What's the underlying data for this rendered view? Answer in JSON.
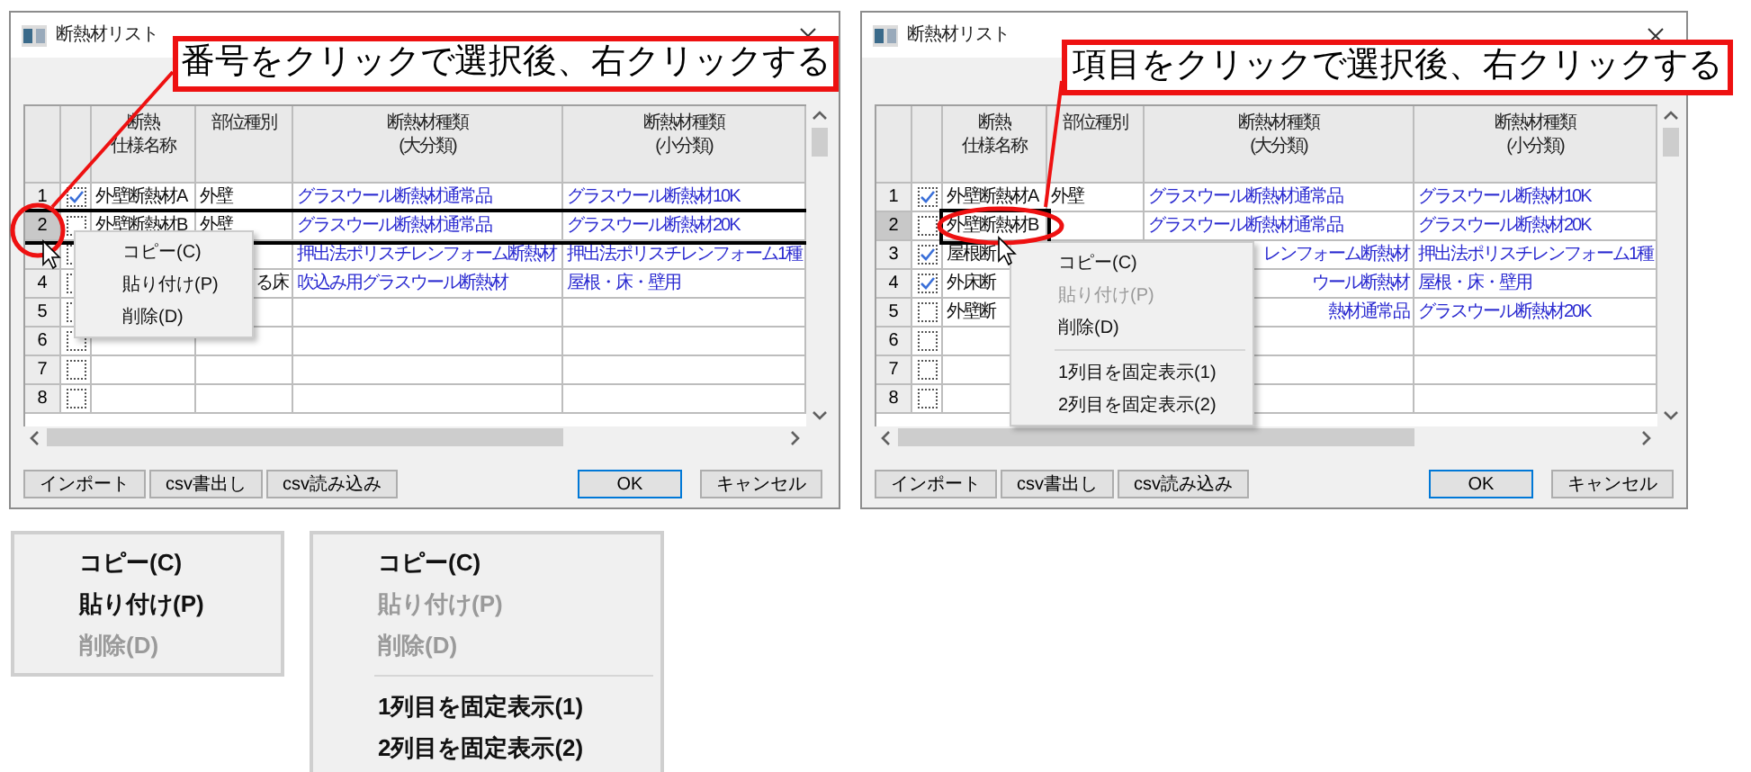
{
  "windows": [
    {
      "title": "断熱材リスト",
      "callout": "番号をクリックで選択後、右クリックする",
      "table": {
        "cell_selection": false,
        "columns": [
          {
            "lines": [
              "断熱",
              "仕様名称"
            ]
          },
          {
            "lines": [
              "部位種別"
            ]
          },
          {
            "lines": [
              "断熱材種類",
              "(大分類)"
            ]
          },
          {
            "lines": [
              "断熱材種類",
              "(小分類)"
            ]
          }
        ],
        "rows": [
          {
            "number": "1",
            "checked": true,
            "selected": false,
            "cells": [
              {
                "text": "外壁断熱材A"
              },
              {
                "text": "外壁"
              },
              {
                "text": "グラスウール断熱材通常品"
              },
              {
                "text": "グラスウール断熱材10K"
              }
            ]
          },
          {
            "number": "2",
            "checked": false,
            "selected": true,
            "cells": [
              {
                "text": "外壁断熱材B"
              },
              {
                "text": "外壁"
              },
              {
                "text": "グラスウール断熱材通常品"
              },
              {
                "text": "グラスウール断熱材20K"
              }
            ]
          },
          {
            "checked": false,
            "selected": false,
            "cells": [
              {},
              {},
              {
                "text": "押出法ポリスチレンフォーム断熱材"
              },
              {
                "text": "押出法ポリスチレンフォーム1種"
              }
            ]
          },
          {
            "number": "4",
            "checked": false,
            "selected": false,
            "cells": [
              {},
              {
                "text": "る床",
                "clipped": true
              },
              {
                "text": "吹込み用グラスウール断熱材"
              },
              {
                "text": "屋根・床・壁用"
              }
            ]
          },
          {
            "number": "5",
            "checked": false,
            "selected": false,
            "cells": [
              {},
              {},
              {},
              {}
            ]
          },
          {
            "number": "6",
            "checked": false,
            "selected": false,
            "cells": [
              {},
              {},
              {},
              {}
            ]
          },
          {
            "number": "7",
            "checked": false,
            "selected": false,
            "cells": [
              {},
              {},
              {},
              {}
            ]
          },
          {
            "number": "8",
            "checked": false,
            "selected": false,
            "cells": [
              {},
              {},
              {},
              {}
            ]
          }
        ]
      },
      "context_menu": {
        "items": [
          {
            "kind": "item",
            "label": "コピー(C)",
            "disabled": false
          },
          {
            "kind": "item",
            "label": "貼り付け(P)",
            "disabled": false
          },
          {
            "kind": "item",
            "label": "削除(D)",
            "disabled": false
          }
        ]
      },
      "buttons": [
        {
          "label": "インポート",
          "default": false
        },
        {
          "label": "csv書出し",
          "default": false
        },
        {
          "label": "csv読み込み",
          "default": false
        },
        {
          "label": "OK",
          "default": true
        },
        {
          "label": "キャンセル",
          "default": false
        }
      ]
    },
    {
      "title": "断熱材リスト",
      "callout": "項目をクリックで選択後、右クリックする",
      "table": {
        "cell_selection": true,
        "columns": [
          {
            "lines": [
              "断熱",
              "仕様名称"
            ]
          },
          {
            "lines": [
              "部位種別"
            ]
          },
          {
            "lines": [
              "断熱材種類",
              "(大分類)"
            ]
          },
          {
            "lines": [
              "断熱材種類",
              "(小分類)"
            ]
          }
        ],
        "rows": [
          {
            "number": "1",
            "checked": true,
            "selected": false,
            "cells": [
              {
                "text": "外壁断熱材A"
              },
              {
                "text": "外壁"
              },
              {
                "text": "グラスウール断熱材通常品"
              },
              {
                "text": "グラスウール断熱材10K"
              }
            ]
          },
          {
            "number": "2",
            "checked": false,
            "selected": true,
            "cells": [
              {
                "text": "外壁断熱材B"
              },
              {},
              {
                "text": "グラスウール断熱材通常品"
              },
              {
                "text": "グラスウール断熱材20K"
              }
            ]
          },
          {
            "number": "3",
            "checked": true,
            "selected": false,
            "cells": [
              {
                "text": "屋根断"
              },
              {},
              {
                "text": "レンフォーム断熱材",
                "clipped": true
              },
              {
                "text": "押出法ポリスチレンフォーム1種"
              }
            ]
          },
          {
            "number": "4",
            "checked": true,
            "selected": false,
            "cells": [
              {
                "text": "外床断"
              },
              {},
              {
                "text": "ウール断熱材",
                "clipped": true
              },
              {
                "text": "屋根・床・壁用"
              }
            ]
          },
          {
            "number": "5",
            "checked": false,
            "selected": false,
            "cells": [
              {
                "text": "外壁断"
              },
              {},
              {
                "text": "熱材通常品",
                "clipped": true
              },
              {
                "text": "グラスウール断熱材20K"
              }
            ]
          },
          {
            "number": "6",
            "checked": false,
            "selected": false,
            "cells": [
              {},
              {},
              {},
              {}
            ]
          },
          {
            "number": "7",
            "checked": false,
            "selected": false,
            "cells": [
              {},
              {},
              {},
              {}
            ]
          },
          {
            "number": "8",
            "checked": false,
            "selected": false,
            "cells": [
              {},
              {},
              {},
              {}
            ]
          }
        ]
      },
      "context_menu": {
        "items": [
          {
            "kind": "item",
            "label": "コピー(C)",
            "disabled": false
          },
          {
            "kind": "item",
            "label": "貼り付け(P)",
            "disabled": true
          },
          {
            "kind": "item",
            "label": "削除(D)",
            "disabled": false
          },
          {
            "kind": "separator"
          },
          {
            "kind": "item",
            "label": "1列目を固定表示(1)",
            "disabled": false
          },
          {
            "kind": "item",
            "label": "2列目を固定表示(2)",
            "disabled": false
          }
        ]
      },
      "buttons": [
        {
          "label": "インポート",
          "default": false
        },
        {
          "label": "csv書出し",
          "default": false
        },
        {
          "label": "csv読み込み",
          "default": false
        },
        {
          "label": "OK",
          "default": true
        },
        {
          "label": "キャンセル",
          "default": false
        }
      ]
    }
  ],
  "enlarged_menus": [
    {
      "items": [
        {
          "kind": "item",
          "label": "コピー(C)",
          "disabled": false
        },
        {
          "kind": "item",
          "label": "貼り付け(P)",
          "disabled": false
        },
        {
          "kind": "item",
          "label": "削除(D)",
          "disabled": true
        }
      ]
    },
    {
      "items": [
        {
          "kind": "item",
          "label": "コピー(C)",
          "disabled": false
        },
        {
          "kind": "item",
          "label": "貼り付け(P)",
          "disabled": true
        },
        {
          "kind": "item",
          "label": "削除(D)",
          "disabled": true
        },
        {
          "kind": "separator"
        },
        {
          "kind": "item",
          "label": "1列目を固定表示(1)",
          "disabled": false
        },
        {
          "kind": "item",
          "label": "2列目を固定表示(2)",
          "disabled": false
        }
      ]
    }
  ]
}
